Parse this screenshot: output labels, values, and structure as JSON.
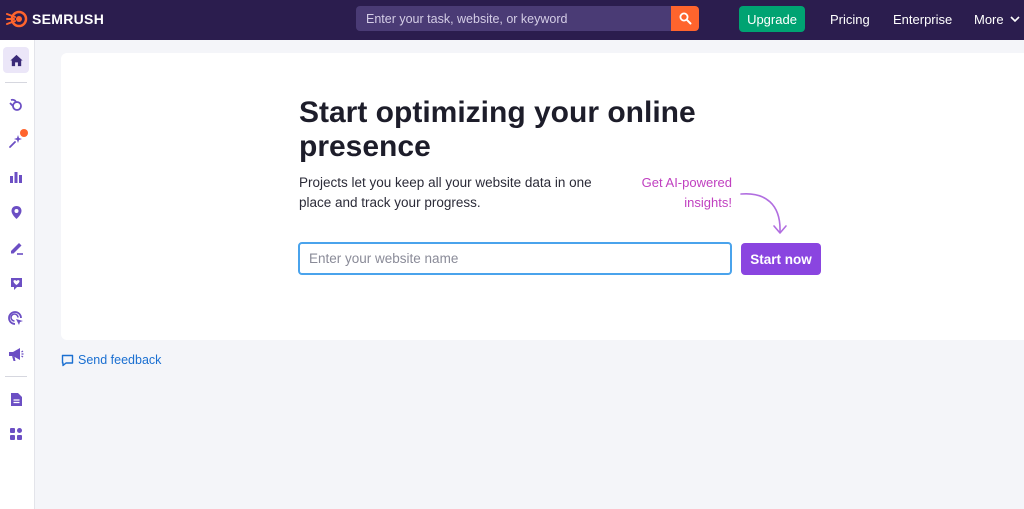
{
  "header": {
    "logo_text": "SEMRUSH",
    "search_placeholder": "Enter your task, website, or keyword",
    "upgrade_label": "Upgrade",
    "links": {
      "pricing": "Pricing",
      "enterprise": "Enterprise",
      "more": "More"
    }
  },
  "sidebar": {
    "items": [
      {
        "icon": "home-icon",
        "active": true
      },
      {
        "icon": "seo-icon"
      },
      {
        "icon": "ai-sparkle-icon",
        "badge": true
      },
      {
        "icon": "bar-chart-icon"
      },
      {
        "icon": "location-pin-icon"
      },
      {
        "icon": "pen-icon"
      },
      {
        "icon": "heart-chat-icon"
      },
      {
        "icon": "target-cursor-icon"
      },
      {
        "icon": "megaphone-icon"
      },
      {
        "icon": "document-icon"
      },
      {
        "icon": "apps-icon"
      }
    ]
  },
  "main": {
    "title": "Start optimizing your online presence",
    "description": "Projects let you keep all your website data in one place and track your progress.",
    "ai_hint": "Get AI-powered insights!",
    "input_placeholder": "Enter your website name",
    "input_value": "",
    "start_label": "Start now"
  },
  "feedback": {
    "label": "Send feedback"
  },
  "colors": {
    "topbar": "#2b1d4e",
    "accent_orange": "#ff642d",
    "upgrade_green": "#00a372",
    "primary_purple": "#8a45e0",
    "sidebar_icon": "#6c4fc4",
    "hint_pink": "#c040c0",
    "link_blue": "#1a6fd1"
  }
}
